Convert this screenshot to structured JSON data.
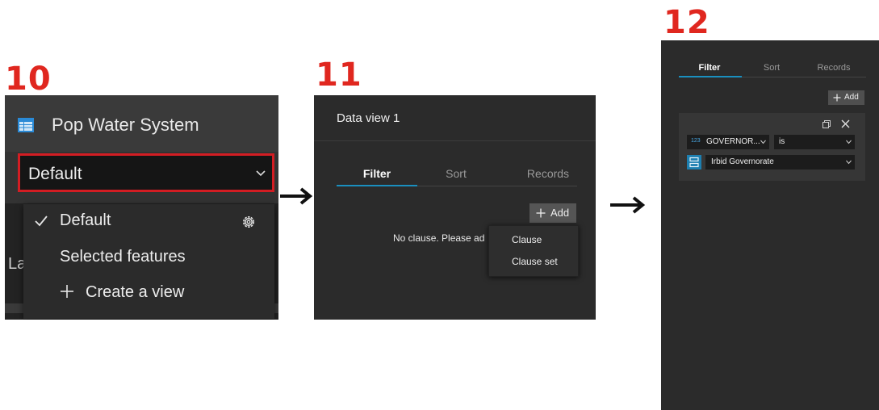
{
  "steps": {
    "s10": "10",
    "s11": "11",
    "s12": "12"
  },
  "panel10": {
    "layer_title": "Pop Water System",
    "icon": "table-icon",
    "selected_view": "Default",
    "menu": [
      {
        "label": "Default",
        "icon": "check-icon",
        "trailing_icon": "gear-icon"
      },
      {
        "label": "Selected features"
      },
      {
        "label": "Create a view",
        "icon": "plus-icon"
      }
    ],
    "background_text": "La"
  },
  "panel11": {
    "header": "Data view 1",
    "tabs": [
      "Filter",
      "Sort",
      "Records"
    ],
    "active_tab": "Filter",
    "add_label": "Add",
    "empty_message": "No clause. Please ad",
    "popup_options": [
      "Clause",
      "Clause set"
    ]
  },
  "panel12": {
    "tabs": [
      "Filter",
      "Sort",
      "Records"
    ],
    "active_tab": "Filter",
    "add_label": "Add",
    "clause": {
      "field_type_badge": "123",
      "field": "GOVERNOR...",
      "operator": "is",
      "value": "Irbid Governorate"
    }
  },
  "colors": {
    "step_number": "#e0271f",
    "highlight_border": "#d31d23",
    "accent": "#1a8fbf",
    "panel_bg": "#2b2b2b"
  }
}
